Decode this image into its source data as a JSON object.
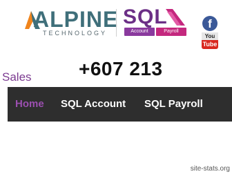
{
  "header": {
    "alpine_logo": {
      "name": "ALPINE",
      "tagline": "TECHNOLOGY"
    },
    "sql_logo": {
      "name": "SQL",
      "tag_account": "Account",
      "tag_payroll": "Payroll"
    },
    "social": {
      "facebook_glyph": "f",
      "youtube_top": "You",
      "youtube_bottom": "Tube"
    }
  },
  "contact": {
    "sales_label": "Sales",
    "phone": "+607 213"
  },
  "nav": {
    "items": [
      {
        "label": "Home",
        "active": true
      },
      {
        "label": "SQL Account",
        "active": false
      },
      {
        "label": "SQL Payroll",
        "active": false
      }
    ]
  },
  "watermark": "site-stats.org",
  "colors": {
    "nav_bg": "#2e2e2e",
    "nav_active": "#9b4fb0",
    "sales_purple": "#7b3a90",
    "sql_purple": "#6b2f86",
    "alpine_teal": "#3f6f7a",
    "alpine_orange": "#f0841c"
  },
  "icons": [
    "alpine-mountain-icon",
    "sql-chevron-icon",
    "facebook-icon",
    "youtube-icon"
  ]
}
